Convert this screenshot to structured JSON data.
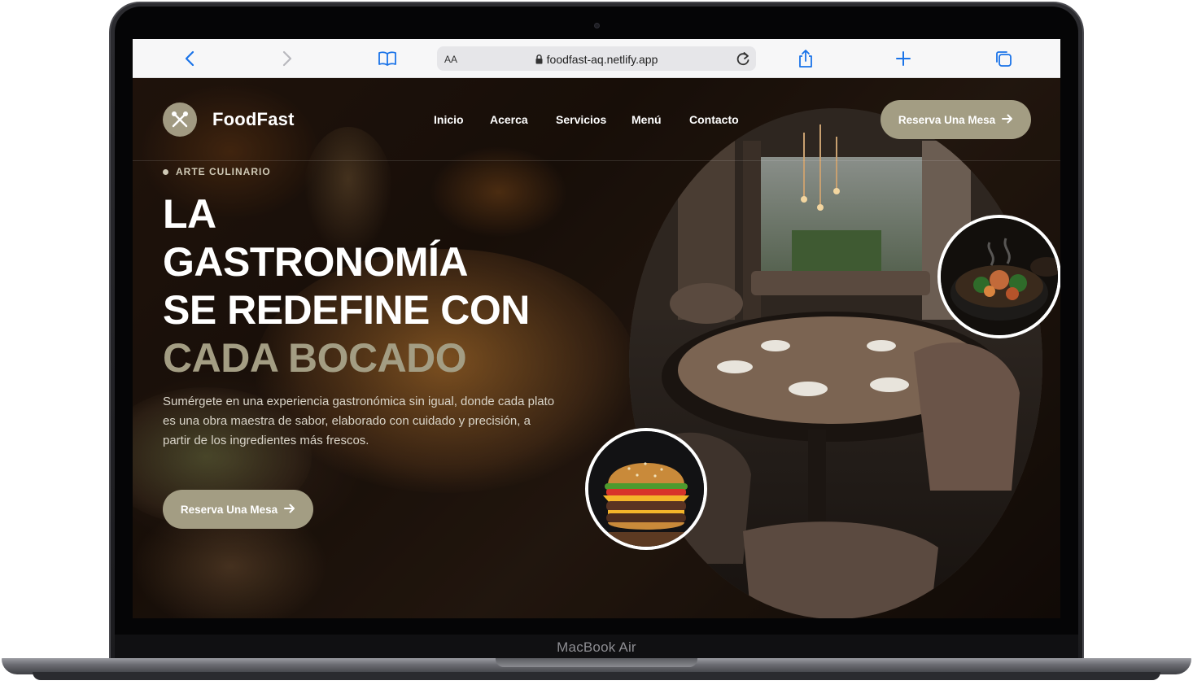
{
  "device": {
    "label": "MacBook Air"
  },
  "browser": {
    "address_aa": "AA",
    "url": "foodfast-aq.netlify.app"
  },
  "site": {
    "brand": "FoodFast",
    "nav": [
      "Inicio",
      "Acerca",
      "Servicios",
      "Menú",
      "Contacto"
    ],
    "cta_header": "Reserva Una Mesa",
    "hero": {
      "eyebrow": "ARTE CULINARIO",
      "title_lines": [
        "LA",
        "GASTRONOMÍA",
        "SE REDEFINE CON"
      ],
      "title_accent": "CADA BOCADO",
      "lead": "Sumérgete en una experiencia gastronómica sin igual, donde cada plato es una obra maestra de sabor, elaborado con cuidado y precisión, a partir de los ingredientes más frescos.",
      "cta": "Reserva Una Mesa"
    }
  },
  "colors": {
    "accent": "#a39d83",
    "page_bg": "#1e130c",
    "toolbar_bg": "#f7f7f8",
    "safari_blue": "#1a73e8"
  },
  "icons": [
    "back-icon",
    "forward-icon",
    "bookmarks-icon",
    "lock-icon",
    "reload-icon",
    "share-icon",
    "new-tab-icon",
    "tabs-icon",
    "utensils-icon",
    "arrow-right-icon"
  ]
}
